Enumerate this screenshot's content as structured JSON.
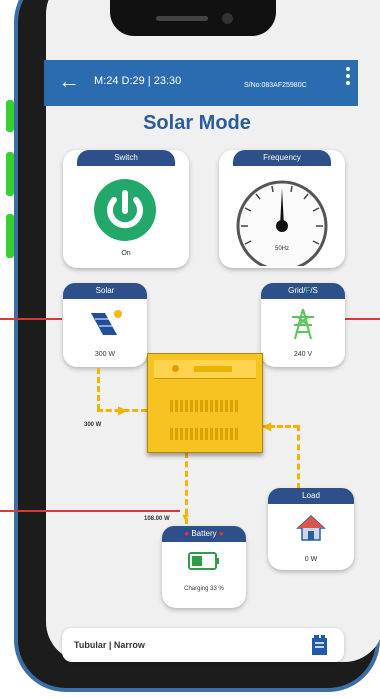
{
  "header": {
    "time_text": "M:24 D:29 | 23:30",
    "serial_text": "S/No:083AF25980C"
  },
  "page": {
    "title": "Solar Mode"
  },
  "switch_card": {
    "title": "Switch",
    "state": "On",
    "color": "#22a86b"
  },
  "frequency_card": {
    "title": "Frequency",
    "value": "50Hz"
  },
  "solar_card": {
    "title": "Solar",
    "power": "300 W",
    "flow_label": "300 W"
  },
  "grid_card": {
    "title_prefix": "Grid/",
    "title_highlight": "F",
    "title_suffix": "/S",
    "voltage": "240 V"
  },
  "battery_card": {
    "title": "Battery",
    "status": "Charging 33 %",
    "flow_label": "108.00 W"
  },
  "load_card": {
    "title": "Load",
    "power": "0 W"
  },
  "footer": {
    "label": "Tubular | Narrow"
  },
  "colors": {
    "header": "#2b6cb0",
    "tab": "#2d4f8a",
    "flow": "#f2b400",
    "inverter": "#f7c322",
    "callout_line": "#d83a3a"
  }
}
